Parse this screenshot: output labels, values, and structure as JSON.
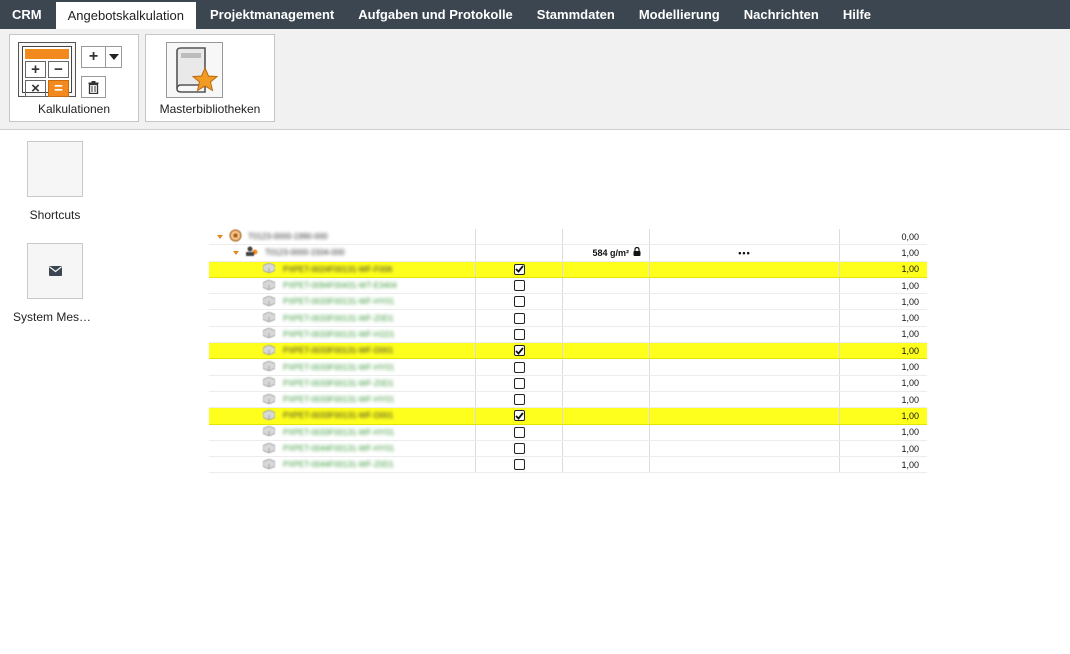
{
  "nav": {
    "tabs": [
      {
        "label": "CRM"
      },
      {
        "label": "Angebotskalkulation"
      },
      {
        "label": "Projektmanagement"
      },
      {
        "label": "Aufgaben und Protokolle"
      },
      {
        "label": "Stammdaten"
      },
      {
        "label": "Modellierung"
      },
      {
        "label": "Nachrichten"
      },
      {
        "label": "Hilfe"
      }
    ],
    "active_tab": "Angebotskalkulation"
  },
  "ribbon": {
    "kalkulationen_label": "Kalkulationen",
    "masterbibliotheken_label": "Masterbibliotheken"
  },
  "shortcuts": {
    "shortcuts_label": "Shortcuts",
    "system_messages_label": "System Mes…"
  },
  "table": {
    "rows": [
      {
        "level": 0,
        "name": "T0123-0000-1990-000",
        "checked": null,
        "weight": "",
        "extra": "",
        "value": "0,00",
        "highlight": false
      },
      {
        "level": 1,
        "name": "T0123-0000-1504-000",
        "checked": null,
        "weight": "584 g/m²",
        "extra": "•••",
        "value": "1,00",
        "highlight": false
      },
      {
        "level": 2,
        "name": "PXPET-0024F00131-WF-F006",
        "checked": true,
        "weight": "",
        "extra": "",
        "value": "1,00",
        "highlight": true
      },
      {
        "level": 2,
        "name": "PXPET-0094F00431-WT-E3404",
        "checked": false,
        "weight": "",
        "extra": "",
        "value": "1,00",
        "highlight": false
      },
      {
        "level": 2,
        "name": "PXPET-0033F00131-WF-HY01",
        "checked": false,
        "weight": "",
        "extra": "",
        "value": "1,00",
        "highlight": false
      },
      {
        "level": 2,
        "name": "PXPET-0033F00131-WF-Z0D1",
        "checked": false,
        "weight": "",
        "extra": "",
        "value": "1,00",
        "highlight": false
      },
      {
        "level": 2,
        "name": "PXPET-0033F00131-WF-H1D1",
        "checked": false,
        "weight": "",
        "extra": "",
        "value": "1,00",
        "highlight": false
      },
      {
        "level": 2,
        "name": "PXPET-0033F00131-WF-D001",
        "checked": true,
        "weight": "",
        "extra": "",
        "value": "1,00",
        "highlight": true
      },
      {
        "level": 2,
        "name": "PXPET-0033F00131-WF-HY01",
        "checked": false,
        "weight": "",
        "extra": "",
        "value": "1,00",
        "highlight": false
      },
      {
        "level": 2,
        "name": "PXPET-0033F00131-WF-Z0D1",
        "checked": false,
        "weight": "",
        "extra": "",
        "value": "1,00",
        "highlight": false
      },
      {
        "level": 2,
        "name": "PXPET-0033F00131-WF-HY01",
        "checked": false,
        "weight": "",
        "extra": "",
        "value": "1,00",
        "highlight": false
      },
      {
        "level": 2,
        "name": "PXPET-0033F00131-WF-D001",
        "checked": true,
        "weight": "",
        "extra": "",
        "value": "1,00",
        "highlight": true
      },
      {
        "level": 2,
        "name": "PXPET-0033F00131-WF-HY01",
        "checked": false,
        "weight": "",
        "extra": "",
        "value": "1,00",
        "highlight": false
      },
      {
        "level": 2,
        "name": "PXPET-0044F00131-WF-HY01",
        "checked": false,
        "weight": "",
        "extra": "",
        "value": "1,00",
        "highlight": false
      },
      {
        "level": 2,
        "name": "PXPET-0044F00131-WF-Z0D1",
        "checked": false,
        "weight": "",
        "extra": "",
        "value": "1,00",
        "highlight": false
      }
    ]
  },
  "colors": {
    "nav_bg": "#3b4650",
    "accent_orange": "#f28a1d",
    "highlight_row": "#ffff1e"
  }
}
